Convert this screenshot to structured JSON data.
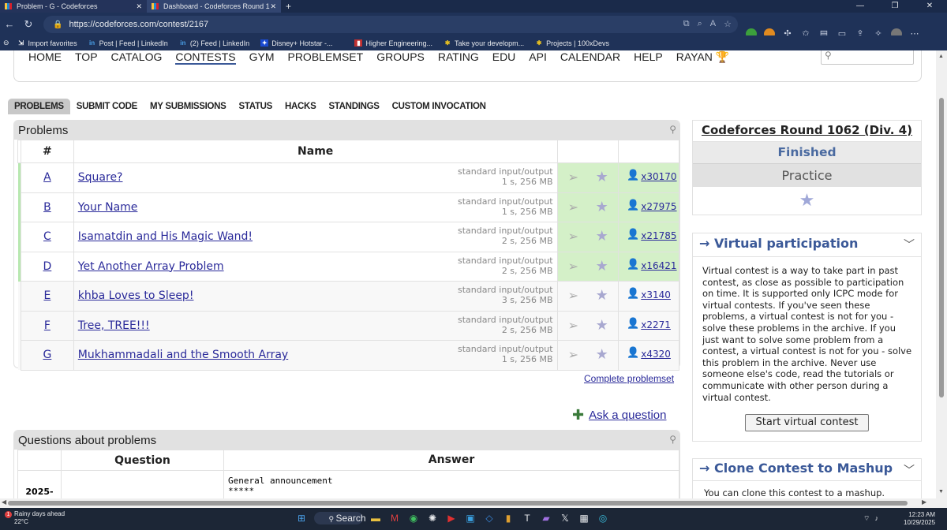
{
  "browser": {
    "tabs": [
      {
        "title": "Problem - G - Codeforces",
        "active": false
      },
      {
        "title": "Dashboard - Codeforces Round 1",
        "active": true
      }
    ],
    "url": "https://codeforces.com/contest/2167",
    "bookmarks": [
      "Import favorites",
      "Post | Feed | LinkedIn",
      "(2) Feed | LinkedIn",
      "Disney+ Hotstar -...",
      "Higher Engineering...",
      "Take your developm...",
      "Projects | 100xDevs"
    ]
  },
  "topmenu": {
    "items": [
      "HOME",
      "TOP",
      "CATALOG",
      "CONTESTS",
      "GYM",
      "PROBLEMSET",
      "GROUPS",
      "RATING",
      "EDU",
      "API",
      "CALENDAR",
      "HELP",
      "RAYAN"
    ],
    "current": "CONTESTS"
  },
  "submenu": {
    "items": [
      "PROBLEMS",
      "SUBMIT CODE",
      "MY SUBMISSIONS",
      "STATUS",
      "HACKS",
      "STANDINGS",
      "CUSTOM INVOCATION"
    ],
    "selected": "PROBLEMS"
  },
  "problems": {
    "title": "Problems",
    "col_index": "#",
    "col_name": "Name",
    "rows": [
      {
        "index": "A",
        "name": "Square?",
        "io": "standard input/output",
        "limits": "1 s, 256 MB",
        "solved": "x30170",
        "accepted": true
      },
      {
        "index": "B",
        "name": "Your Name",
        "io": "standard input/output",
        "limits": "1 s, 256 MB",
        "solved": "x27975",
        "accepted": true
      },
      {
        "index": "C",
        "name": "Isamatdin and His Magic Wand!",
        "io": "standard input/output",
        "limits": "2 s, 256 MB",
        "solved": "x21785",
        "accepted": true
      },
      {
        "index": "D",
        "name": "Yet Another Array Problem",
        "io": "standard input/output",
        "limits": "2 s, 256 MB",
        "solved": "x16421",
        "accepted": true
      },
      {
        "index": "E",
        "name": "khba Loves to Sleep!",
        "io": "standard input/output",
        "limits": "3 s, 256 MB",
        "solved": "x3140",
        "accepted": false
      },
      {
        "index": "F",
        "name": "Tree, TREE!!!",
        "io": "standard input/output",
        "limits": "2 s, 256 MB",
        "solved": "x2271",
        "accepted": false
      },
      {
        "index": "G",
        "name": "Mukhammadali and the Smooth Array",
        "io": "standard input/output",
        "limits": "1 s, 256 MB",
        "solved": "x4320",
        "accepted": false
      }
    ],
    "complete_link": "Complete problemset",
    "ask_link": "Ask a question"
  },
  "questions": {
    "title": "Questions about problems",
    "col_question": "Question",
    "col_answer": "Answer",
    "row_date": "2025-",
    "row_answer_line1": "General announcement",
    "row_answer_line2": "*****"
  },
  "sidebar": {
    "contest_name": "Codeforces Round 1062 (Div. 4)",
    "status": "Finished",
    "practice": "Practice",
    "virtual_title": "→ Virtual participation",
    "virtual_text": "Virtual contest is a way to take part in past contest, as close as possible to participation on time. It is supported only ICPC mode for virtual contests. If you've seen these problems, a virtual contest is not for you - solve these problems in the archive. If you just want to solve some problem from a contest, a virtual contest is not for you - solve this problem in the archive. Never use someone else's code, read the tutorials or communicate with other person during a virtual contest.",
    "virtual_button": "Start virtual contest",
    "clone_title": "→ Clone Contest to Mashup",
    "clone_text": "You can clone this contest to a mashup."
  },
  "taskbar": {
    "weather_line1": "Rainy days ahead",
    "weather_line2": "22°C",
    "search_label": "Search",
    "time": "12:23 AM",
    "date": "10/29/2025"
  }
}
